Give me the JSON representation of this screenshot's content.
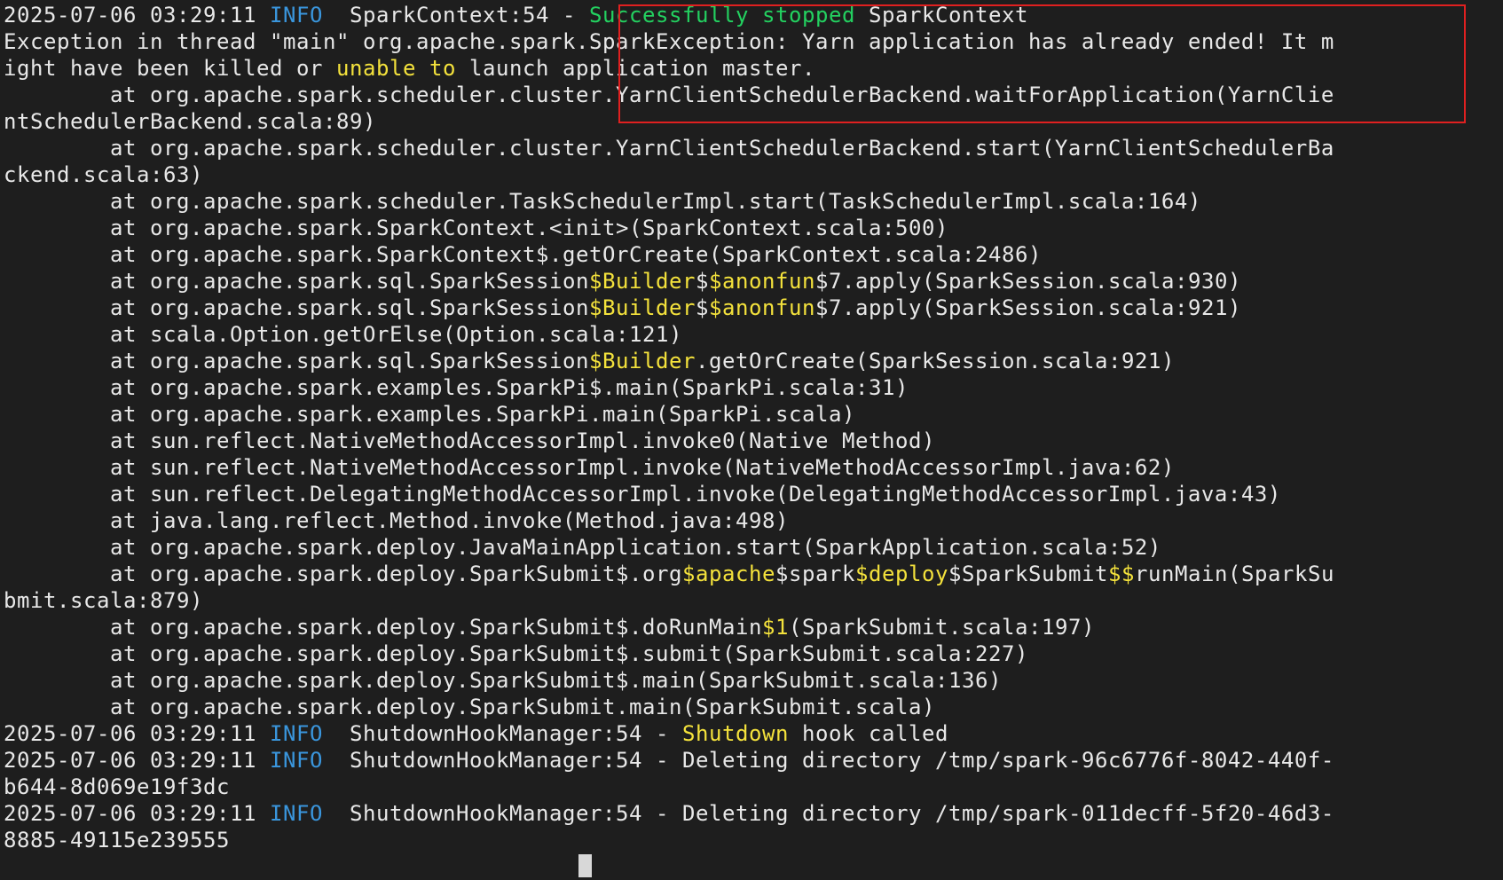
{
  "terminal": {
    "lines": [
      {
        "segments": [
          {
            "text": "2025-07-06 03:29:11 ",
            "cls": "ts"
          },
          {
            "text": "INFO",
            "cls": "info"
          },
          {
            "text": "  SparkContext:54 - ",
            "cls": ""
          },
          {
            "text": "Successfully stopped",
            "cls": "ok"
          },
          {
            "text": " SparkContext",
            "cls": ""
          }
        ]
      },
      {
        "segments": [
          {
            "text": "Exception in thread \"main\" org.apache.spark.SparkException: Yarn application has already ended! It m",
            "cls": ""
          }
        ]
      },
      {
        "segments": [
          {
            "text": "ight have been killed or ",
            "cls": ""
          },
          {
            "text": "unable to",
            "cls": "hl"
          },
          {
            "text": " launch application master.",
            "cls": ""
          }
        ]
      },
      {
        "segments": [
          {
            "text": "        at org.apache.spark.scheduler.cluster.YarnClientSchedulerBackend.waitForApplication(YarnClie",
            "cls": ""
          }
        ]
      },
      {
        "segments": [
          {
            "text": "ntSchedulerBackend.scala:89)",
            "cls": ""
          }
        ]
      },
      {
        "segments": [
          {
            "text": "        at org.apache.spark.scheduler.cluster.YarnClientSchedulerBackend.start(YarnClientSchedulerBa",
            "cls": ""
          }
        ]
      },
      {
        "segments": [
          {
            "text": "ckend.scala:63)",
            "cls": ""
          }
        ]
      },
      {
        "segments": [
          {
            "text": "        at org.apache.spark.scheduler.TaskSchedulerImpl.start(TaskSchedulerImpl.scala:164)",
            "cls": ""
          }
        ]
      },
      {
        "segments": [
          {
            "text": "        at org.apache.spark.SparkContext.<init>(SparkContext.scala:500)",
            "cls": ""
          }
        ]
      },
      {
        "segments": [
          {
            "text": "        at org.apache.spark.SparkContext$.getOrCreate(SparkContext.scala:2486)",
            "cls": ""
          }
        ]
      },
      {
        "segments": [
          {
            "text": "        at org.apache.spark.sql.SparkSession",
            "cls": ""
          },
          {
            "text": "$Builder",
            "cls": "hl"
          },
          {
            "text": "$",
            "cls": ""
          },
          {
            "text": "$anonfun",
            "cls": "hl"
          },
          {
            "text": "$7.apply(SparkSession.scala:930)",
            "cls": ""
          }
        ]
      },
      {
        "segments": [
          {
            "text": "        at org.apache.spark.sql.SparkSession",
            "cls": ""
          },
          {
            "text": "$Builder",
            "cls": "hl"
          },
          {
            "text": "$",
            "cls": ""
          },
          {
            "text": "$anonfun",
            "cls": "hl"
          },
          {
            "text": "$7.apply(SparkSession.scala:921)",
            "cls": ""
          }
        ]
      },
      {
        "segments": [
          {
            "text": "        at scala.Option.getOrElse(Option.scala:121)",
            "cls": ""
          }
        ]
      },
      {
        "segments": [
          {
            "text": "        at org.apache.spark.sql.SparkSession",
            "cls": ""
          },
          {
            "text": "$Builder",
            "cls": "hl"
          },
          {
            "text": ".getOrCreate(SparkSession.scala:921)",
            "cls": ""
          }
        ]
      },
      {
        "segments": [
          {
            "text": "        at org.apache.spark.examples.SparkPi$.main(SparkPi.scala:31)",
            "cls": ""
          }
        ]
      },
      {
        "segments": [
          {
            "text": "        at org.apache.spark.examples.SparkPi.main(SparkPi.scala)",
            "cls": ""
          }
        ]
      },
      {
        "segments": [
          {
            "text": "        at sun.reflect.NativeMethodAccessorImpl.invoke0(Native Method)",
            "cls": ""
          }
        ]
      },
      {
        "segments": [
          {
            "text": "        at sun.reflect.NativeMethodAccessorImpl.invoke(NativeMethodAccessorImpl.java:62)",
            "cls": ""
          }
        ]
      },
      {
        "segments": [
          {
            "text": "        at sun.reflect.DelegatingMethodAccessorImpl.invoke(DelegatingMethodAccessorImpl.java:43)",
            "cls": ""
          }
        ]
      },
      {
        "segments": [
          {
            "text": "        at java.lang.reflect.Method.invoke(Method.java:498)",
            "cls": ""
          }
        ]
      },
      {
        "segments": [
          {
            "text": "        at org.apache.spark.deploy.JavaMainApplication.start(SparkApplication.scala:52)",
            "cls": ""
          }
        ]
      },
      {
        "segments": [
          {
            "text": "        at org.apache.spark.deploy.SparkSubmit$.org",
            "cls": ""
          },
          {
            "text": "$apache",
            "cls": "hl"
          },
          {
            "text": "$spark",
            "cls": ""
          },
          {
            "text": "$deploy",
            "cls": "hl"
          },
          {
            "text": "$SparkSubmit",
            "cls": ""
          },
          {
            "text": "$$",
            "cls": "hl"
          },
          {
            "text": "runMain(SparkSu",
            "cls": ""
          }
        ]
      },
      {
        "segments": [
          {
            "text": "bmit.scala:879)",
            "cls": ""
          }
        ]
      },
      {
        "segments": [
          {
            "text": "        at org.apache.spark.deploy.SparkSubmit$.doRunMain",
            "cls": ""
          },
          {
            "text": "$1",
            "cls": "hl"
          },
          {
            "text": "(SparkSubmit.scala:197)",
            "cls": ""
          }
        ]
      },
      {
        "segments": [
          {
            "text": "        at org.apache.spark.deploy.SparkSubmit$.submit(SparkSubmit.scala:227)",
            "cls": ""
          }
        ]
      },
      {
        "segments": [
          {
            "text": "        at org.apache.spark.deploy.SparkSubmit$.main(SparkSubmit.scala:136)",
            "cls": ""
          }
        ]
      },
      {
        "segments": [
          {
            "text": "        at org.apache.spark.deploy.SparkSubmit.main(SparkSubmit.scala)",
            "cls": ""
          }
        ]
      },
      {
        "segments": [
          {
            "text": "2025-07-06 03:29:11 ",
            "cls": "ts"
          },
          {
            "text": "INFO",
            "cls": "info"
          },
          {
            "text": "  ShutdownHookManager:54 - ",
            "cls": ""
          },
          {
            "text": "Shutdown",
            "cls": "hl"
          },
          {
            "text": " hook called",
            "cls": ""
          }
        ]
      },
      {
        "segments": [
          {
            "text": "2025-07-06 03:29:11 ",
            "cls": "ts"
          },
          {
            "text": "INFO",
            "cls": "info"
          },
          {
            "text": "  ShutdownHookManager:54 - Deleting directory /tmp/spark-96c6776f-8042-440f-",
            "cls": ""
          }
        ]
      },
      {
        "segments": [
          {
            "text": "b644-8d069e19f3dc",
            "cls": ""
          }
        ]
      },
      {
        "segments": [
          {
            "text": "2025-07-06 03:29:11 ",
            "cls": "ts"
          },
          {
            "text": "INFO",
            "cls": "info"
          },
          {
            "text": "  ShutdownHookManager:54 - Deleting directory /tmp/spark-011decff-5f20-46d3-",
            "cls": ""
          }
        ]
      },
      {
        "segments": [
          {
            "text": "8885-49115e239555",
            "cls": ""
          }
        ]
      }
    ],
    "colors": {
      "background": "#1e1e1e",
      "foreground": "#e8e8e8",
      "info": "#3a96dd",
      "highlight": "#f4e23c",
      "success": "#23d160",
      "annotation_box": "#e02020"
    }
  }
}
